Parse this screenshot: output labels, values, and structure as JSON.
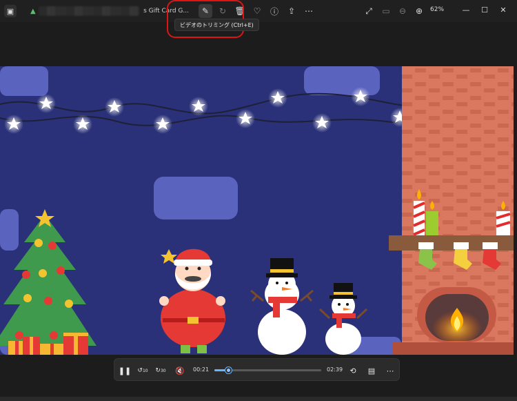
{
  "titlebar": {
    "file_title": "s Gift Card G...",
    "zoom": "62%",
    "tooltip": "ビデオのトリミング (Ctrl+E)"
  },
  "icons": {
    "app": "photos-app-icon",
    "edit_video": "video-edit-icon",
    "rotate": "rotate-icon",
    "delete": "delete-icon",
    "favorite": "heart-icon",
    "info": "info-icon",
    "share": "share-icon",
    "more": "more-icon",
    "fullscreen": "expand-icon",
    "actual_size": "actual-size-icon",
    "zoom_out": "zoom-out-icon",
    "zoom_in": "zoom-in-icon"
  },
  "player": {
    "current_time": "00:21",
    "total_time": "02:39",
    "progress": 0.132,
    "skip_back_label": "10",
    "skip_forward_label": "30"
  },
  "colors": {
    "accent": "#6ab3ff",
    "highlight": "#e01414",
    "sky": "#2a3178",
    "brick": "#d9775f"
  }
}
